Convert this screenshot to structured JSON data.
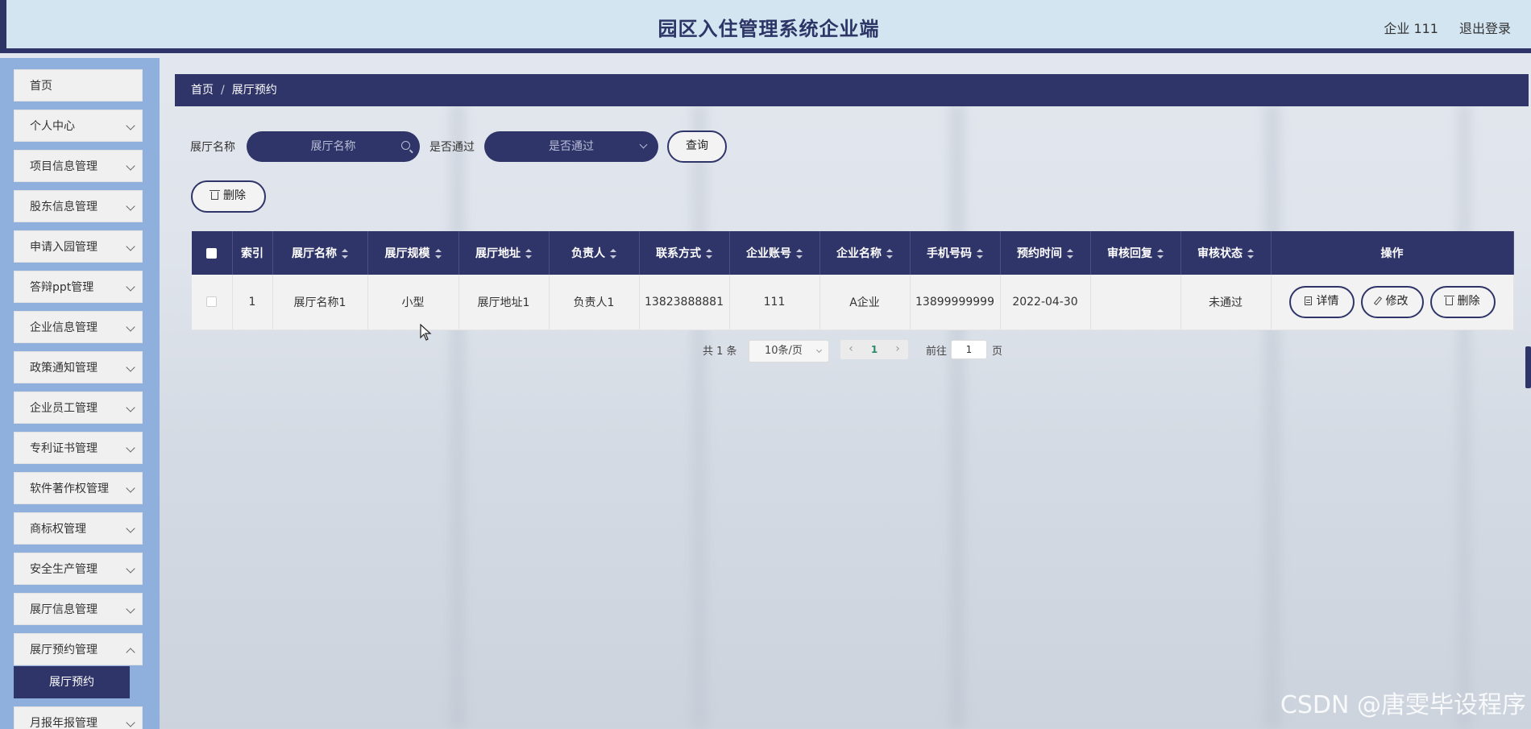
{
  "header": {
    "title": "园区入住管理系统企业端",
    "user": "企业 111",
    "logout": "退出登录"
  },
  "sidebar": {
    "items": [
      {
        "label": "首页",
        "expandable": false
      },
      {
        "label": "个人中心",
        "expandable": true
      },
      {
        "label": "项目信息管理",
        "expandable": true
      },
      {
        "label": "股东信息管理",
        "expandable": true
      },
      {
        "label": "申请入园管理",
        "expandable": true
      },
      {
        "label": "答辩ppt管理",
        "expandable": true
      },
      {
        "label": "企业信息管理",
        "expandable": true
      },
      {
        "label": "政策通知管理",
        "expandable": true
      },
      {
        "label": "企业员工管理",
        "expandable": true
      },
      {
        "label": "专利证书管理",
        "expandable": true
      },
      {
        "label": "软件著作权管理",
        "expandable": true
      },
      {
        "label": "商标权管理",
        "expandable": true
      },
      {
        "label": "安全生产管理",
        "expandable": true
      },
      {
        "label": "展厅信息管理",
        "expandable": true
      },
      {
        "label": "展厅预约管理",
        "expandable": true
      },
      {
        "label": "月报年报管理",
        "expandable": true
      }
    ],
    "active_sub": "展厅预约"
  },
  "breadcrumb": {
    "home": "首页",
    "sep": "/",
    "current": "展厅预约"
  },
  "search": {
    "name_label": "展厅名称",
    "name_placeholder": "展厅名称",
    "pass_label": "是否通过",
    "pass_placeholder": "是否通过",
    "query_button": "查询",
    "delete_button": "删除"
  },
  "table": {
    "headers": [
      "索引",
      "展厅名称",
      "展厅规模",
      "展厅地址",
      "负责人",
      "联系方式",
      "企业账号",
      "企业名称",
      "手机号码",
      "预约时间",
      "审核回复",
      "审核状态",
      "操作"
    ],
    "rows": [
      {
        "index": "1",
        "name": "展厅名称1",
        "scale": "小型",
        "address": "展厅地址1",
        "manager": "负责人1",
        "contact": "13823888881",
        "account": "111",
        "company": "A企业",
        "phone": "13899999999",
        "time": "2022-04-30",
        "reply": "",
        "status": "未通过"
      }
    ],
    "actions": {
      "detail": "详情",
      "edit": "修改",
      "delete": "删除"
    }
  },
  "pagination": {
    "total": "共 1 条",
    "page_size": "10条/页",
    "prev": "‹",
    "current": "1",
    "next": "›",
    "goto_label": "前往",
    "goto_value": "1",
    "page_label": "页"
  },
  "watermark": "CSDN @唐雯毕设程序",
  "colors": {
    "primary": "#2f3568",
    "header_bg": "#d3e5f0",
    "sidebar_bg": "#8fb0dc"
  }
}
